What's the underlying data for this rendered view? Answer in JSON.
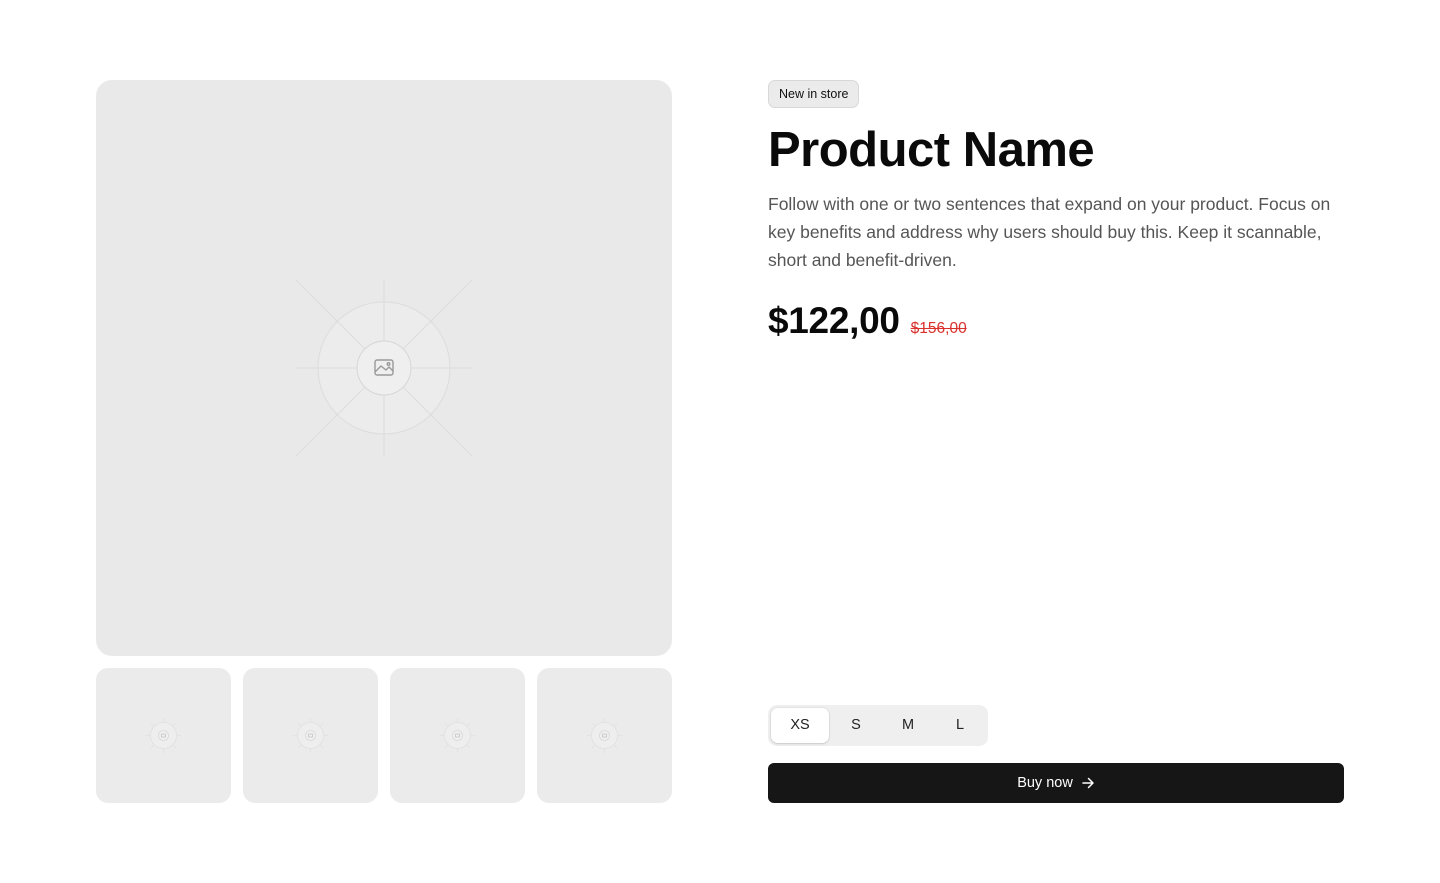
{
  "gallery": {
    "main_image_icon": "image-placeholder-icon",
    "thumbnails": [
      {
        "icon": "image-placeholder-icon"
      },
      {
        "icon": "image-placeholder-icon"
      },
      {
        "icon": "image-placeholder-icon"
      },
      {
        "icon": "image-placeholder-icon"
      }
    ]
  },
  "product": {
    "badge": "New in store",
    "name": "Product Name",
    "description": "Follow with one or two sentences that expand on your product. Focus on key benefits and address why users should buy this. Keep it scannable, short and benefit-driven.",
    "price": "$122,00",
    "old_price": "$156,00"
  },
  "sizes": {
    "options": [
      "XS",
      "S",
      "M",
      "L"
    ],
    "selected": "XS"
  },
  "buy_button": {
    "label": "Buy now",
    "icon": "arrow-right-icon"
  },
  "colors": {
    "placeholder_bg": "#e9e9e9",
    "old_price": "#d9302c",
    "button_bg": "#161616"
  }
}
